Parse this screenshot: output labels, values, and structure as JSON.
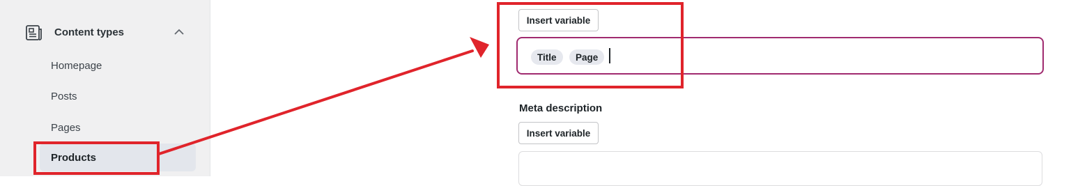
{
  "sidebar": {
    "section": {
      "label": "Content types",
      "icon": "content-types-icon",
      "expanded": true
    },
    "items": [
      {
        "label": "Homepage",
        "active": false
      },
      {
        "label": "Posts",
        "active": false
      },
      {
        "label": "Pages",
        "active": false
      },
      {
        "label": "Products",
        "active": true
      }
    ]
  },
  "seo_title": {
    "insert_variable_label": "Insert variable",
    "variables": [
      "Title",
      "Page"
    ]
  },
  "meta_description": {
    "label": "Meta description",
    "insert_variable_label": "Insert variable",
    "value": ""
  },
  "colors": {
    "annotation": "#e0242b",
    "focus_border": "#a02a6f"
  }
}
